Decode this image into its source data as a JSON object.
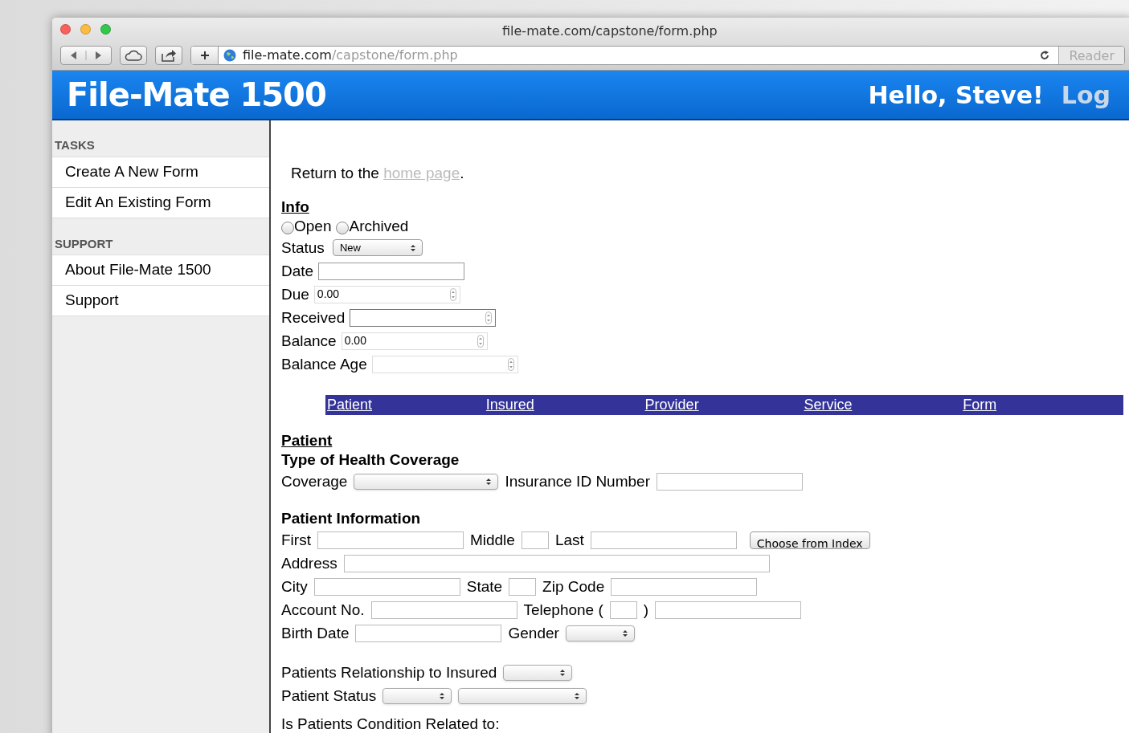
{
  "browser": {
    "title": "file-mate.com/capstone/form.php",
    "url_host": "file-mate.com",
    "url_path": "/capstone/form.php",
    "reader": "Reader"
  },
  "header": {
    "title": "File-Mate 1500",
    "greeting": "Hello, Steve!",
    "logout": "Log"
  },
  "sidebar": [
    {
      "heading": "TASKS",
      "items": [
        "Create A New Form",
        "Edit An Existing Form"
      ]
    },
    {
      "heading": "SUPPORT",
      "items": [
        "About File-Mate 1500",
        "Support"
      ]
    }
  ],
  "return_text": {
    "before": "Return to the",
    "link": "home page",
    "after": "."
  },
  "info": {
    "heading": "Info",
    "radios": [
      {
        "label": "Open",
        "selected": false
      },
      {
        "label": "Archived",
        "selected": false
      }
    ],
    "status": {
      "label": "Status",
      "value": "New"
    },
    "fields": [
      {
        "label": "Date",
        "kind": "text"
      },
      {
        "label": "Due",
        "kind": "number",
        "value": "0.00",
        "focused": false
      },
      {
        "label": "Received",
        "kind": "number",
        "focused": true
      },
      {
        "label": "Balance",
        "kind": "number",
        "value": "0.00",
        "focused": false
      },
      {
        "label": "Balance Age",
        "kind": "number",
        "focused": false
      }
    ]
  },
  "tabs": [
    "Patient",
    "Insured",
    "Provider",
    "Service",
    "Form"
  ],
  "patient": {
    "heading": "Patient",
    "groups": [
      {
        "title": "Type of Health Coverage",
        "rows": [
          [
            {
              "kind": "label",
              "text": "Coverage"
            },
            {
              "kind": "wide_select"
            },
            {
              "kind": "label",
              "text": "Insurance ID Number"
            },
            {
              "kind": "text"
            }
          ]
        ]
      },
      {
        "title": "Patient Information",
        "rows": [
          [
            {
              "kind": "label",
              "text": "First"
            },
            {
              "kind": "text"
            },
            {
              "kind": "label",
              "text": "Middle"
            },
            {
              "kind": "short_text"
            },
            {
              "kind": "label",
              "text": "Last"
            },
            {
              "kind": "text"
            },
            {
              "kind": "button",
              "text": "Choose from Index"
            }
          ],
          [
            {
              "kind": "label",
              "text": "Address"
            },
            {
              "kind": "wide_text"
            }
          ],
          [
            {
              "kind": "label",
              "text": "City"
            },
            {
              "kind": "text"
            },
            {
              "kind": "label",
              "text": "State"
            },
            {
              "kind": "short_text"
            },
            {
              "kind": "label",
              "text": "Zip Code"
            },
            {
              "kind": "text"
            }
          ],
          [
            {
              "kind": "label",
              "text": "Account No."
            },
            {
              "kind": "text"
            },
            {
              "kind": "label",
              "text": "Telephone ("
            },
            {
              "kind": "short_text"
            },
            {
              "kind": "label",
              "text": ")"
            },
            {
              "kind": "text"
            }
          ],
          [
            {
              "kind": "label",
              "text": "Birth Date"
            },
            {
              "kind": "text"
            },
            {
              "kind": "label",
              "text": "Gender"
            },
            {
              "kind": "select"
            }
          ]
        ]
      },
      {
        "rows": [
          [
            {
              "kind": "label",
              "text": "Patients Relationship to Insured"
            },
            {
              "kind": "select"
            }
          ],
          [
            {
              "kind": "label",
              "text": "Patient Status"
            },
            {
              "kind": "select"
            },
            {
              "kind": "medium_select"
            }
          ]
        ]
      },
      {
        "rows": [
          [
            {
              "kind": "label",
              "text": "Is Patients Condition Related to:"
            }
          ]
        ]
      }
    ]
  }
}
